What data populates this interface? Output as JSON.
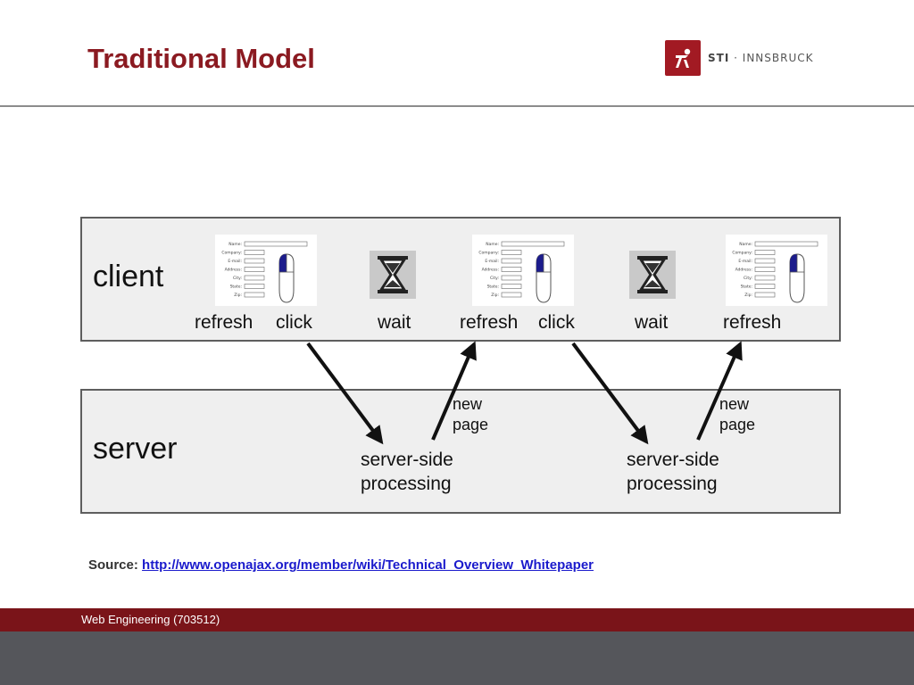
{
  "slide": {
    "title": "Traditional Model",
    "logo": {
      "brand": "STI",
      "separator": "·",
      "city": "INNSBRUCK",
      "color": "#a21a23"
    },
    "source_label": "Source:",
    "source_link": "http://www.openajax.org/member/wiki/Technical_Overview_Whitepaper",
    "footer": "Web Engineering (703512)"
  },
  "diagram": {
    "client_label": "client",
    "server_label": "server",
    "client_events": [
      "refresh",
      "click",
      "wait",
      "refresh",
      "click",
      "wait",
      "refresh"
    ],
    "new_page": [
      "new",
      "page"
    ],
    "server_processing": [
      "server-side",
      "processing"
    ],
    "form_fields": [
      "Name",
      "Company",
      "E-mail",
      "Address",
      "City",
      "State",
      "Zip"
    ],
    "icons": [
      "form-thumbnail-icon",
      "mouse-icon",
      "hourglass-icon"
    ]
  },
  "colors": {
    "title": "#8b1a21",
    "footer_bar": "#7a1419",
    "footer_base": "#55565b",
    "link": "#1a1acc"
  }
}
